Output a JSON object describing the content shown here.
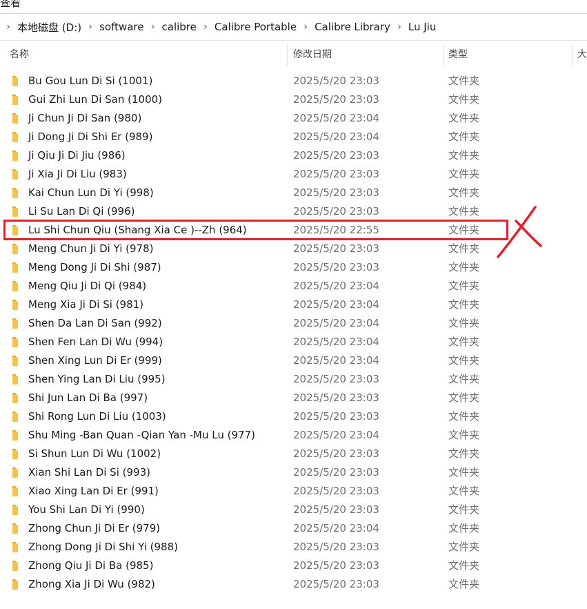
{
  "menu": {
    "view_label_cut": "查看"
  },
  "breadcrumb": {
    "items": [
      "本地磁盘 (D:)",
      "software",
      "calibre",
      "Calibre Portable",
      "Calibre Library",
      "Lu Jiu"
    ]
  },
  "columns": {
    "name": "名称",
    "date": "修改日期",
    "type": "类型",
    "size_cut": "大"
  },
  "files": [
    {
      "name": "Bu Gou Lun Di Si (1001)",
      "date": "2025/5/20 23:03",
      "type": "文件夹"
    },
    {
      "name": "Gui Zhi Lun Di San (1000)",
      "date": "2025/5/20 23:03",
      "type": "文件夹"
    },
    {
      "name": "Ji Chun Ji Di San (980)",
      "date": "2025/5/20 23:04",
      "type": "文件夹"
    },
    {
      "name": "Ji Dong Ji Di Shi Er (989)",
      "date": "2025/5/20 23:04",
      "type": "文件夹"
    },
    {
      "name": "Ji Qiu Ji Di Jiu (986)",
      "date": "2025/5/20 23:03",
      "type": "文件夹"
    },
    {
      "name": "Ji Xia Ji Di Liu (983)",
      "date": "2025/5/20 23:03",
      "type": "文件夹"
    },
    {
      "name": "Kai Chun Lun Di Yi (998)",
      "date": "2025/5/20 23:03",
      "type": "文件夹"
    },
    {
      "name": "Li Su Lan Di Qi (996)",
      "date": "2025/5/20 23:03",
      "type": "文件夹"
    },
    {
      "name": "Lu Shi Chun Qiu (Shang Xia Ce )--Zh (964)",
      "date": "2025/5/20 22:55",
      "type": "文件夹"
    },
    {
      "name": "Meng Chun Ji Di Yi (978)",
      "date": "2025/5/20 23:03",
      "type": "文件夹"
    },
    {
      "name": "Meng Dong Ji Di Shi (987)",
      "date": "2025/5/20 23:03",
      "type": "文件夹"
    },
    {
      "name": "Meng Qiu Ji Di Qi (984)",
      "date": "2025/5/20 23:04",
      "type": "文件夹"
    },
    {
      "name": "Meng Xia Ji Di Si (981)",
      "date": "2025/5/20 23:04",
      "type": "文件夹"
    },
    {
      "name": "Shen Da Lan Di San (992)",
      "date": "2025/5/20 23:04",
      "type": "文件夹"
    },
    {
      "name": "Shen Fen Lan Di Wu (994)",
      "date": "2025/5/20 23:04",
      "type": "文件夹"
    },
    {
      "name": "Shen Xing Lun Di Er (999)",
      "date": "2025/5/20 23:04",
      "type": "文件夹"
    },
    {
      "name": "Shen Ying Lan Di Liu (995)",
      "date": "2025/5/20 23:03",
      "type": "文件夹"
    },
    {
      "name": "Shi Jun Lan Di Ba (997)",
      "date": "2025/5/20 23:03",
      "type": "文件夹"
    },
    {
      "name": "Shi Rong Lun Di Liu (1003)",
      "date": "2025/5/20 23:03",
      "type": "文件夹"
    },
    {
      "name": "Shu Ming -Ban Quan -Qian Yan -Mu Lu (977)",
      "date": "2025/5/20 23:04",
      "type": "文件夹"
    },
    {
      "name": "Si Shun Lun Di Wu (1002)",
      "date": "2025/5/20 23:03",
      "type": "文件夹"
    },
    {
      "name": "Xian Shi Lan Di Si (993)",
      "date": "2025/5/20 23:03",
      "type": "文件夹"
    },
    {
      "name": "Xiao Xing Lan Di Er (991)",
      "date": "2025/5/20 23:03",
      "type": "文件夹"
    },
    {
      "name": "You Shi Lan Di Yi (990)",
      "date": "2025/5/20 23:03",
      "type": "文件夹"
    },
    {
      "name": "Zhong Chun Ji Di Er (979)",
      "date": "2025/5/20 23:04",
      "type": "文件夹"
    },
    {
      "name": "Zhong Dong Ji Di Shi Yi (988)",
      "date": "2025/5/20 23:03",
      "type": "文件夹"
    },
    {
      "name": "Zhong Qiu Ji Di Ba (985)",
      "date": "2025/5/20 23:03",
      "type": "文件夹"
    },
    {
      "name": "Zhong Xia Ji Di Wu (982)",
      "date": "2025/5/20 23:03",
      "type": "文件夹"
    }
  ],
  "annotation": {
    "highlight_color": "#e0212a",
    "marked_item": "Lu Shi Chun Qiu (Shang Xia Ce )--Zh (964)"
  },
  "colors": {
    "folder": "#f6c343",
    "secondary_text": "#6d6d6d"
  }
}
